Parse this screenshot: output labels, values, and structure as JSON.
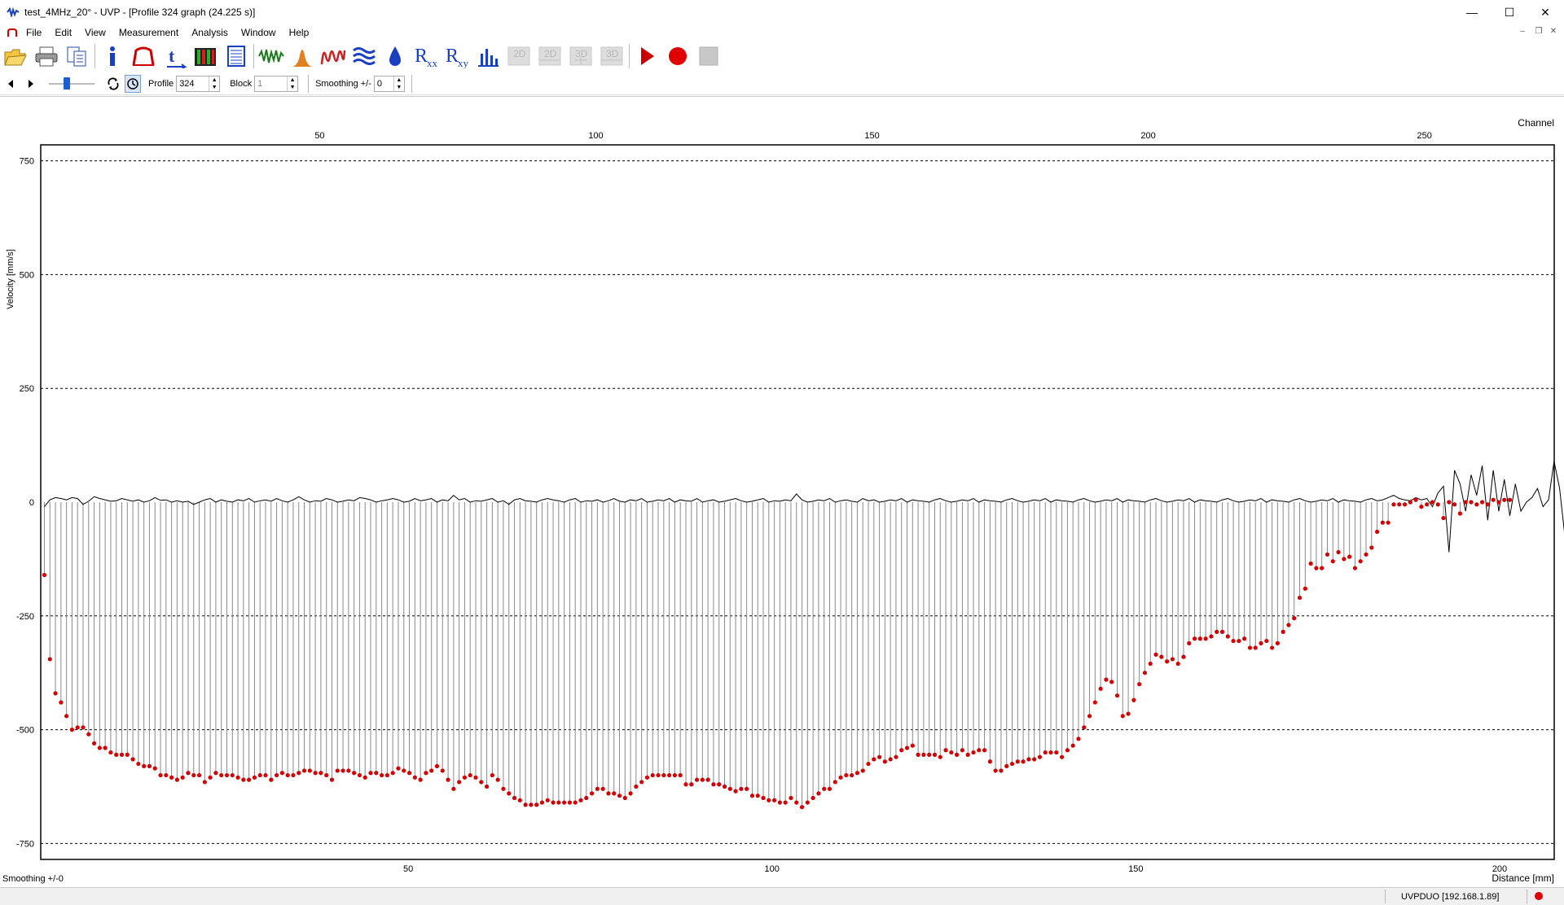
{
  "window": {
    "title": "test_4MHz_20° - UVP - [Profile 324 graph (24.225 s)]",
    "minimize": "—",
    "maximize": "☐",
    "close": "✕"
  },
  "menu": {
    "items": [
      "File",
      "Edit",
      "View",
      "Measurement",
      "Analysis",
      "Window",
      "Help"
    ]
  },
  "toolbar": {
    "icons": [
      "open-folder-icon",
      "print-icon",
      "copy-icon",
      "info-icon",
      "profile-icon",
      "time-axis-icon",
      "color-map-icon",
      "table-icon",
      "signal-wave-icon",
      "histogram-icon",
      "frequency-icon",
      "waves-icon",
      "water-drop-icon",
      "rxx-icon",
      "rxy-icon",
      "bar-chart-icon",
      "2d-icon",
      "2d-grid-icon",
      "3d-icon",
      "3d-grid-icon",
      "play-icon",
      "record-icon",
      "stop-icon"
    ],
    "rxx_label": "R",
    "rxx_sub": "xx",
    "rxy_label": "R",
    "rxy_sub": "xy",
    "label_2d": "2D",
    "label_3d": "3D"
  },
  "toolbar2": {
    "profile_label": "Profile",
    "profile_value": "324",
    "block_label": "Block",
    "block_value": "1",
    "smoothing_label": "Smoothing +/-",
    "smoothing_value": "0"
  },
  "status": {
    "left": "Smoothing +/-0",
    "device": "UVPDUO [192.168.1.89]"
  },
  "colors": {
    "marker": "#d40000",
    "stem": "#8a8a8a",
    "echo_line": "#000000",
    "record": "#e00000",
    "play": "#cc0000",
    "icon_blue": "#1a3fbf"
  },
  "chart_data": {
    "type": "scatter",
    "title": "",
    "ylabel": "Velocity [mm/s]",
    "xlabel": "Distance [mm]",
    "x2label": "Channel",
    "ylim": [
      -785,
      785
    ],
    "xlim": [
      -0.5,
      207.5
    ],
    "x2lim": [
      -0.5,
      273.5
    ],
    "yticks": [
      750,
      500,
      250,
      0,
      -250,
      -500,
      -750
    ],
    "xticks": [
      50,
      100,
      150,
      200
    ],
    "x2ticks": [
      50,
      100,
      150,
      200,
      250
    ],
    "grid": "horizontal-dashed",
    "series": [
      {
        "name": "",
        "x_start": 0,
        "x_step": 0.76,
        "values": [
          -160,
          -345,
          -420,
          -440,
          -470,
          -500,
          -495,
          -495,
          -510,
          -530,
          -540,
          -540,
          -550,
          -555,
          -555,
          -555,
          -565,
          -575,
          -580,
          -580,
          -585,
          -600,
          -600,
          -605,
          -610,
          -605,
          -595,
          -600,
          -600,
          -615,
          -605,
          -595,
          -600,
          -600,
          -600,
          -605,
          -610,
          -610,
          -605,
          -600,
          -600,
          -610,
          -600,
          -595,
          -600,
          -600,
          -595,
          -590,
          -590,
          -595,
          -595,
          -600,
          -610,
          -590,
          -590,
          -590,
          -595,
          -600,
          -605,
          -595,
          -595,
          -600,
          -600,
          -595,
          -585,
          -590,
          -595,
          -605,
          -610,
          -595,
          -590,
          -580,
          -590,
          -610,
          -630,
          -615,
          -605,
          -600,
          -605,
          -615,
          -625,
          -600,
          -610,
          -630,
          -640,
          -650,
          -655,
          -665,
          -665,
          -665,
          -660,
          -655,
          -660,
          -660,
          -660,
          -660,
          -660,
          -655,
          -650,
          -640,
          -630,
          -630,
          -640,
          -640,
          -645,
          -650,
          -640,
          -625,
          -615,
          -605,
          -600,
          -600,
          -600,
          -600,
          -600,
          -600,
          -620,
          -620,
          -610,
          -610,
          -610,
          -620,
          -620,
          -625,
          -630,
          -635,
          -630,
          -630,
          -645,
          -645,
          -650,
          -655,
          -655,
          -660,
          -660,
          -650,
          -660,
          -670,
          -660,
          -650,
          -640,
          -630,
          -630,
          -615,
          -605,
          -600,
          -600,
          -595,
          -590,
          -575,
          -565,
          -560,
          -570,
          -565,
          -560,
          -545,
          -540,
          -535,
          -555,
          -555,
          -555,
          -555,
          -560,
          -545,
          -550,
          -555,
          -545,
          -555,
          -550,
          -545,
          -545,
          -570,
          -590,
          -590,
          -580,
          -575,
          -570,
          -570,
          -565,
          -565,
          -560,
          -550,
          -550,
          -550,
          -560,
          -545,
          -535,
          -520,
          -495,
          -470,
          -440,
          -410,
          -390,
          -395,
          -425,
          -470,
          -465,
          -435,
          -400,
          -375,
          -355,
          -335,
          -340,
          -350,
          -345,
          -355,
          -340,
          -310,
          -300,
          -300,
          -300,
          -295,
          -285,
          -285,
          -295,
          -305,
          -305,
          -300,
          -320,
          -320,
          -310,
          -305,
          -320,
          -310,
          -285,
          -270,
          -255,
          -210,
          -190,
          -135,
          -145,
          -145,
          -115,
          -130,
          -110,
          -125,
          -120,
          -145,
          -130,
          -115,
          -100,
          -65,
          -45,
          -45,
          -5,
          -5,
          -5,
          0,
          5,
          -10,
          -5,
          0,
          -5,
          -35,
          0,
          -5,
          -25,
          0,
          0,
          -5,
          0,
          -5,
          5,
          0,
          5,
          5
        ]
      },
      {
        "name": "",
        "type": "line",
        "x_start": 0,
        "x_step": 0.76,
        "values": [
          -10,
          5,
          10,
          8,
          5,
          10,
          8,
          -5,
          2,
          12,
          8,
          5,
          2,
          3,
          8,
          5,
          2,
          5,
          0,
          3,
          10,
          4,
          5,
          0,
          3,
          0,
          2,
          -5,
          0,
          5,
          8,
          0,
          5,
          2,
          0,
          5,
          3,
          8,
          0,
          3,
          5,
          2,
          8,
          3,
          0,
          5,
          12,
          5,
          0,
          3,
          2,
          8,
          5,
          0,
          2,
          5,
          3,
          10,
          8,
          5,
          0,
          3,
          5,
          8,
          5,
          0,
          2,
          8,
          3,
          5,
          8,
          0,
          5,
          3,
          15,
          5,
          8,
          0,
          3,
          2,
          5,
          8,
          0,
          3,
          -5,
          5,
          8,
          3,
          2,
          0,
          5,
          8,
          5,
          3,
          0,
          5,
          8,
          0,
          3,
          2,
          5,
          0,
          3,
          8,
          2,
          0,
          5,
          3,
          8,
          0,
          2,
          5,
          3,
          8,
          0,
          5,
          3,
          2,
          8,
          0,
          3,
          5,
          0,
          2,
          5,
          8,
          3,
          0,
          2,
          5,
          8,
          0,
          3,
          2,
          5,
          3,
          18,
          5,
          0,
          2,
          5,
          3,
          8,
          0,
          3,
          5,
          2,
          0,
          8,
          3,
          5,
          0,
          2,
          5,
          3,
          8,
          0,
          5,
          3,
          2,
          0,
          5,
          8,
          3,
          0,
          2,
          5,
          3,
          8,
          0,
          5,
          3,
          2,
          0,
          5,
          8,
          3,
          0,
          2,
          5,
          3,
          8,
          0,
          5,
          3,
          2,
          0,
          5,
          8,
          3,
          0,
          2,
          5,
          3,
          8,
          0,
          5,
          3,
          2,
          0,
          5,
          8,
          3,
          0,
          2,
          5,
          3,
          8,
          0,
          5,
          3,
          2,
          0,
          5,
          8,
          3,
          0,
          2,
          5,
          3,
          8,
          0,
          5,
          3,
          2,
          0,
          5,
          8,
          3,
          0,
          2,
          5,
          3,
          8,
          0,
          5,
          3,
          2,
          0,
          5,
          8,
          3,
          5,
          10,
          15,
          8,
          5,
          3,
          10,
          5,
          8,
          -10,
          20,
          35,
          -110,
          70,
          40,
          -20,
          60,
          15,
          80,
          -40,
          70,
          -20,
          50,
          -30,
          40,
          -20,
          0,
          10,
          30,
          -10,
          5,
          90,
          30,
          -80,
          20
        ]
      }
    ]
  }
}
